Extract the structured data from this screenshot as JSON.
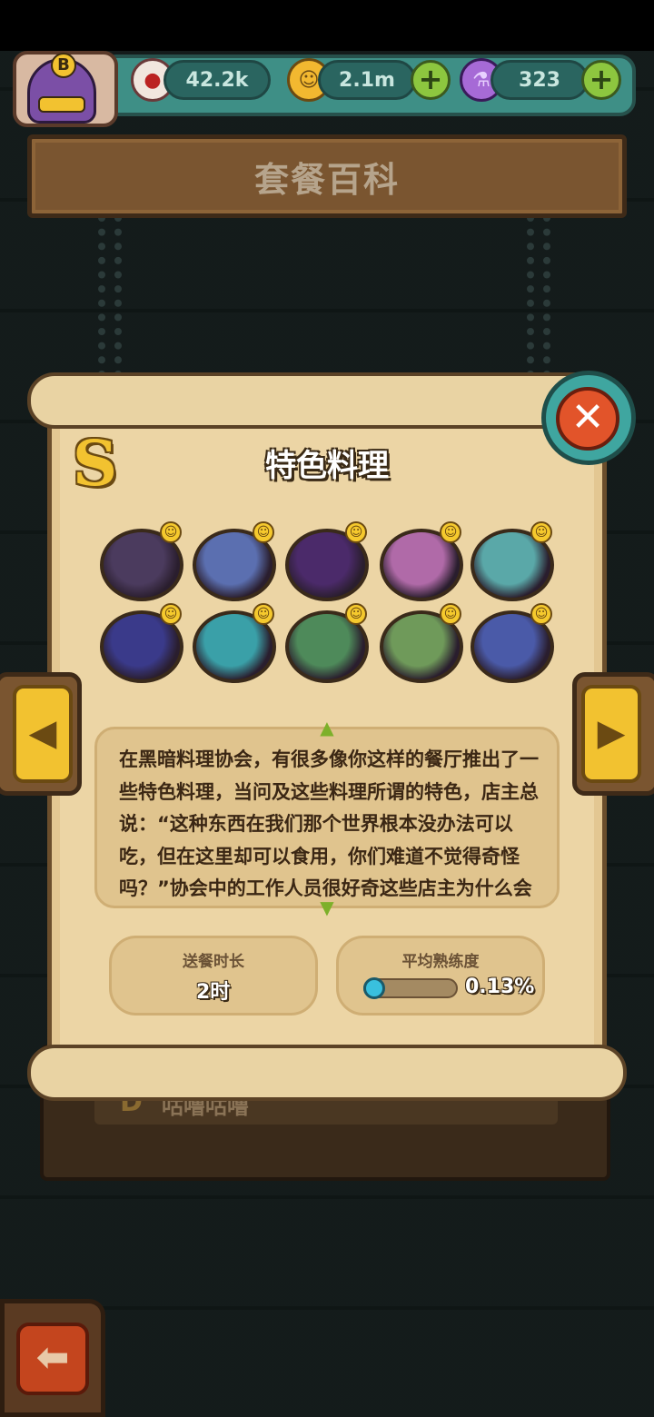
{
  "header": {
    "eyeballs": "42.2k",
    "coins": "2.1m",
    "potions": "323",
    "profile_grade": "B"
  },
  "title": "套餐百科",
  "panel": {
    "grade": "S",
    "title": "特色料理",
    "description": "在黑暗料理协会，有很多像你这样的餐厅推出了一些特色料理，当问及这些料理所谓的特色，店主总说：“这种东西在我们那个世界根本没办法可以吃，但在这里却可以食用，你们难道不觉得奇怪吗？”协会中的工作人员很好奇这些店主为什么会有这些反应，以下是这些",
    "delivery_label": "送餐时长",
    "delivery_value": "2时",
    "mastery_label": "平均熟练度",
    "mastery_value": "0.13%",
    "mastery_fraction": 0.0013
  },
  "dishes": [
    {
      "name": "dish-1",
      "color": "#4b3b5e"
    },
    {
      "name": "dish-2",
      "color": "#5b6fb0"
    },
    {
      "name": "dish-3",
      "color": "#4b2a6a"
    },
    {
      "name": "dish-4",
      "color": "#b06aa8"
    },
    {
      "name": "dish-5",
      "color": "#5aa8a8"
    },
    {
      "name": "dish-6",
      "color": "#3a3a8a"
    },
    {
      "name": "dish-7",
      "color": "#3aa0a8"
    },
    {
      "name": "dish-8",
      "color": "#4e8a5a"
    },
    {
      "name": "dish-9",
      "color": "#6f9a5a"
    },
    {
      "name": "dish-10",
      "color": "#4a5aa8"
    }
  ],
  "background_list": {
    "grade": "D",
    "name": "咕噜咕噜"
  },
  "icons": {
    "eyeball": "eyeball-icon",
    "coin": "coin-icon",
    "potion": "potion-icon",
    "close": "close-icon",
    "left": "arrow-left-icon",
    "right": "arrow-right-icon",
    "back": "back-arrow-icon"
  }
}
